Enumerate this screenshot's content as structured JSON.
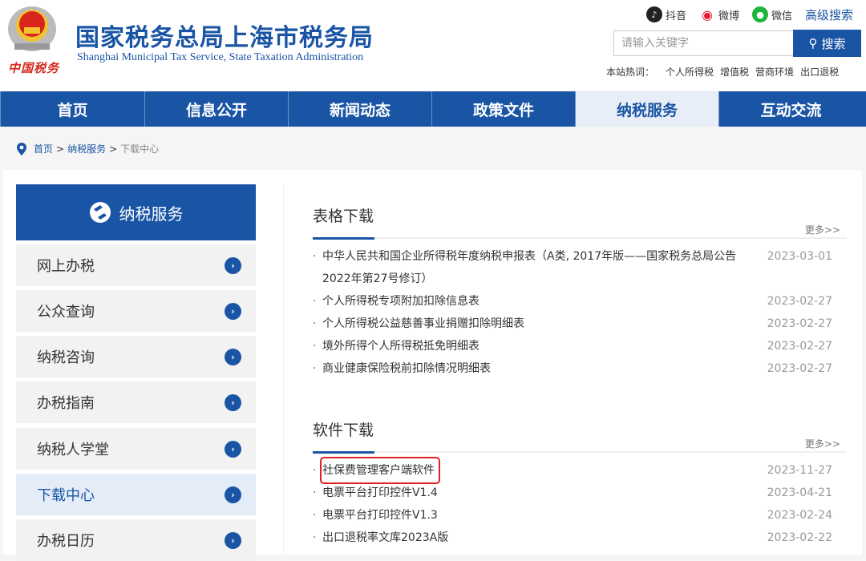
{
  "header": {
    "title": "国家税务总局上海市税务局",
    "subtitle": "Shanghai Municipal Tax Service, State Taxation Administration",
    "emblem_text": "中国税务",
    "social": [
      {
        "icon": "douyin-icon",
        "label": "抖音"
      },
      {
        "icon": "weibo-icon",
        "label": "微博"
      },
      {
        "icon": "wechat-icon",
        "label": "微信"
      }
    ],
    "advanced_search": "高级搜索",
    "search_placeholder": "请输入关键字",
    "search_button": "搜索",
    "hot_label": "本站热词：",
    "hot_words": [
      "个人所得税",
      "增值税",
      "营商环境",
      "出口退税"
    ]
  },
  "nav": [
    {
      "label": "首页"
    },
    {
      "label": "信息公开"
    },
    {
      "label": "新闻动态"
    },
    {
      "label": "政策文件"
    },
    {
      "label": "纳税服务",
      "active": true
    },
    {
      "label": "互动交流"
    }
  ],
  "breadcrumb": [
    "首页",
    "纳税服务",
    "下载中心"
  ],
  "sidebar": {
    "title": "纳税服务",
    "items": [
      "网上办税",
      "公众查询",
      "纳税咨询",
      "办税指南",
      "纳税人学堂",
      "下载中心",
      "办税日历"
    ],
    "active": "下载中心"
  },
  "sections": [
    {
      "title": "表格下载",
      "more": "更多>>",
      "items": [
        {
          "title": "中华人民共和国企业所得税年度纳税申报表（A类, 2017年版——国家税务总局公告2022年第27号修订）",
          "date": "2023-03-01"
        },
        {
          "title": "个人所得税专项附加扣除信息表",
          "date": "2023-02-27"
        },
        {
          "title": "个人所得税公益慈善事业捐赠扣除明细表",
          "date": "2023-02-27"
        },
        {
          "title": "境外所得个人所得税抵免明细表",
          "date": "2023-02-27"
        },
        {
          "title": "商业健康保险税前扣除情况明细表",
          "date": "2023-02-27"
        }
      ]
    },
    {
      "title": "软件下载",
      "more": "更多>>",
      "items": [
        {
          "title": "社保费管理客户端软件",
          "date": "2023-11-27",
          "highlighted": true
        },
        {
          "title": "电票平台打印控件V1.4",
          "date": "2023-04-21"
        },
        {
          "title": "电票平台打印控件V1.3",
          "date": "2023-02-24"
        },
        {
          "title": "出口退税率文库2023A版",
          "date": "2023-02-22"
        }
      ]
    }
  ],
  "colors": {
    "brand": "#1a55a5",
    "highlight": "#e02020"
  }
}
